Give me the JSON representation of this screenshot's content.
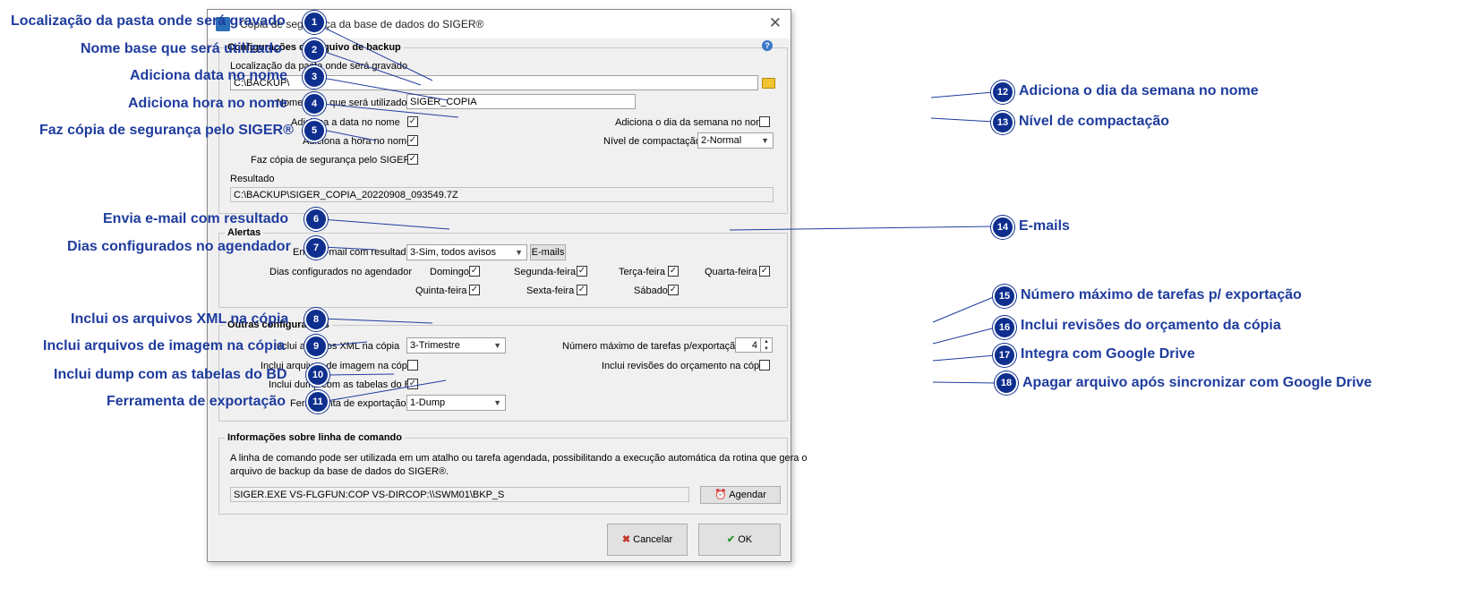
{
  "dialog": {
    "title": "Cópia de segurança da base de dados do SIGER®",
    "close_glyph": "✕"
  },
  "backup_group": {
    "legend": "Configurações do arquivo de backup",
    "folder_label": "Localização da pasta onde será gravado",
    "folder_value": "C:\\BACKUP\\",
    "basename_label": "Nome base que será utilizado",
    "basename_value": "SIGER_COPIA",
    "add_date_label": "Adiciona a data no nome",
    "add_date_checked": true,
    "add_time_label": "Adiciona a hora no nome",
    "add_time_checked": true,
    "siger_backup_label": "Faz cópia de segurança pelo SIGER®",
    "siger_backup_checked": true,
    "weekday_label": "Adiciona o dia da semana no nome",
    "weekday_checked": false,
    "compression_label": "Nível de compactação",
    "compression_value": "2-Normal",
    "result_label": "Resultado",
    "result_value": "C:\\BACKUP\\SIGER_COPIA_20220908_093549.7Z"
  },
  "alerts_group": {
    "legend": "Alertas",
    "email_label": "Envia e-mail com resultado",
    "email_value": "3-Sim, todos avisos",
    "emails_button": "E-mails",
    "days_label": "Dias configurados no agendador",
    "days": [
      {
        "label": "Domingo",
        "checked": true
      },
      {
        "label": "Segunda-feira",
        "checked": true
      },
      {
        "label": "Terça-feira",
        "checked": true
      },
      {
        "label": "Quarta-feira",
        "checked": true
      },
      {
        "label": "Quinta-feira",
        "checked": true
      },
      {
        "label": "Sexta-feira",
        "checked": true
      },
      {
        "label": "Sábado",
        "checked": true
      }
    ]
  },
  "other_group": {
    "legend": "Outras configurações",
    "xml_label": "Inclui arquivos XML na cópia",
    "xml_value": "3-Trimestre",
    "images_label": "Inclui arquivos de imagem na cópia",
    "images_checked": false,
    "dump_label": "Inclui dump com as tabelas do BD",
    "dump_checked": true,
    "tool_label": "Ferramenta de exportação",
    "tool_value": "1-Dump",
    "max_tasks_label": "Número máximo de tarefas p/exportação",
    "max_tasks_value": "4",
    "revisions_label": "Inclui revisões do orçamento na cópia",
    "revisions_checked": false
  },
  "cmd_group": {
    "legend": "Informações sobre linha de comando",
    "description_line1": "A linha de comando pode ser utilizada em um atalho ou tarefa agendada, possibilitando a execução automática da rotina que gera o",
    "description_line2": "arquivo de backup da base de dados do SIGER®.",
    "command_value": "SIGER.EXE VS-FLGFUN:COP VS-DIRCOP:\\\\SWM01\\BKP_S",
    "schedule_button": "Agendar"
  },
  "footer": {
    "cancel_button": "Cancelar",
    "ok_button": "OK"
  },
  "annotations": {
    "left": [
      {
        "num": "1",
        "text": "Localização da pasta onde será gravado"
      },
      {
        "num": "2",
        "text": "Nome base que será utilizado"
      },
      {
        "num": "3",
        "text": "Adiciona data no nome"
      },
      {
        "num": "4",
        "text": "Adiciona hora no nome"
      },
      {
        "num": "5",
        "text": "Faz cópia de segurança pelo SIGER®"
      },
      {
        "num": "6",
        "text": "Envia e-mail com resultado"
      },
      {
        "num": "7",
        "text": "Dias configurados no agendador"
      },
      {
        "num": "8",
        "text": "Inclui os arquivos XML na cópia"
      },
      {
        "num": "9",
        "text": "Inclui arquivos de imagem na cópia"
      },
      {
        "num": "10",
        "text": "Inclui dump com as tabelas do BD"
      },
      {
        "num": "11",
        "text": "Ferramenta de exportação"
      }
    ],
    "right": [
      {
        "num": "12",
        "text": "Adiciona o dia da semana no nome"
      },
      {
        "num": "13",
        "text": "Nível de compactação"
      },
      {
        "num": "14",
        "text": "E-mails"
      },
      {
        "num": "15",
        "text": "Número máximo de tarefas p/ exportação"
      },
      {
        "num": "16",
        "text": "Inclui revisões do orçamento da cópia"
      },
      {
        "num": "17",
        "text": "Integra com Google Drive"
      },
      {
        "num": "18",
        "text": "Apagar arquivo após sincronizar com Google Drive"
      }
    ]
  },
  "colors": {
    "annotation_text": "#1f3c9e",
    "badge": "#0f2f8f",
    "dialog_bg": "#f0f0f0"
  }
}
